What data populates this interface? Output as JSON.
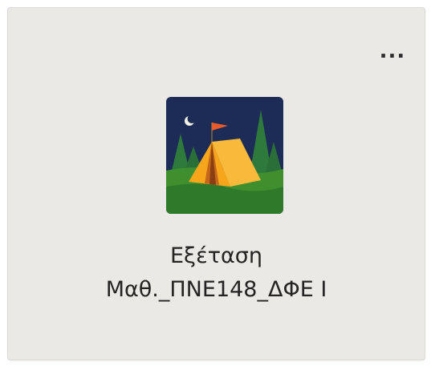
{
  "card": {
    "more_label": "...",
    "name_line1": "Εξέταση",
    "name_line2": "Μαθ._ΠΝΕ148_ΔΦΕ Ι",
    "avatar_icon": "camping-tent-icon"
  },
  "colors": {
    "card_background": "#ebe9e6",
    "sky": "#1c2c57",
    "grass": "#3f8f2f",
    "tent": "#f7a61b",
    "flag": "#e85b2a",
    "text": "#252423"
  }
}
